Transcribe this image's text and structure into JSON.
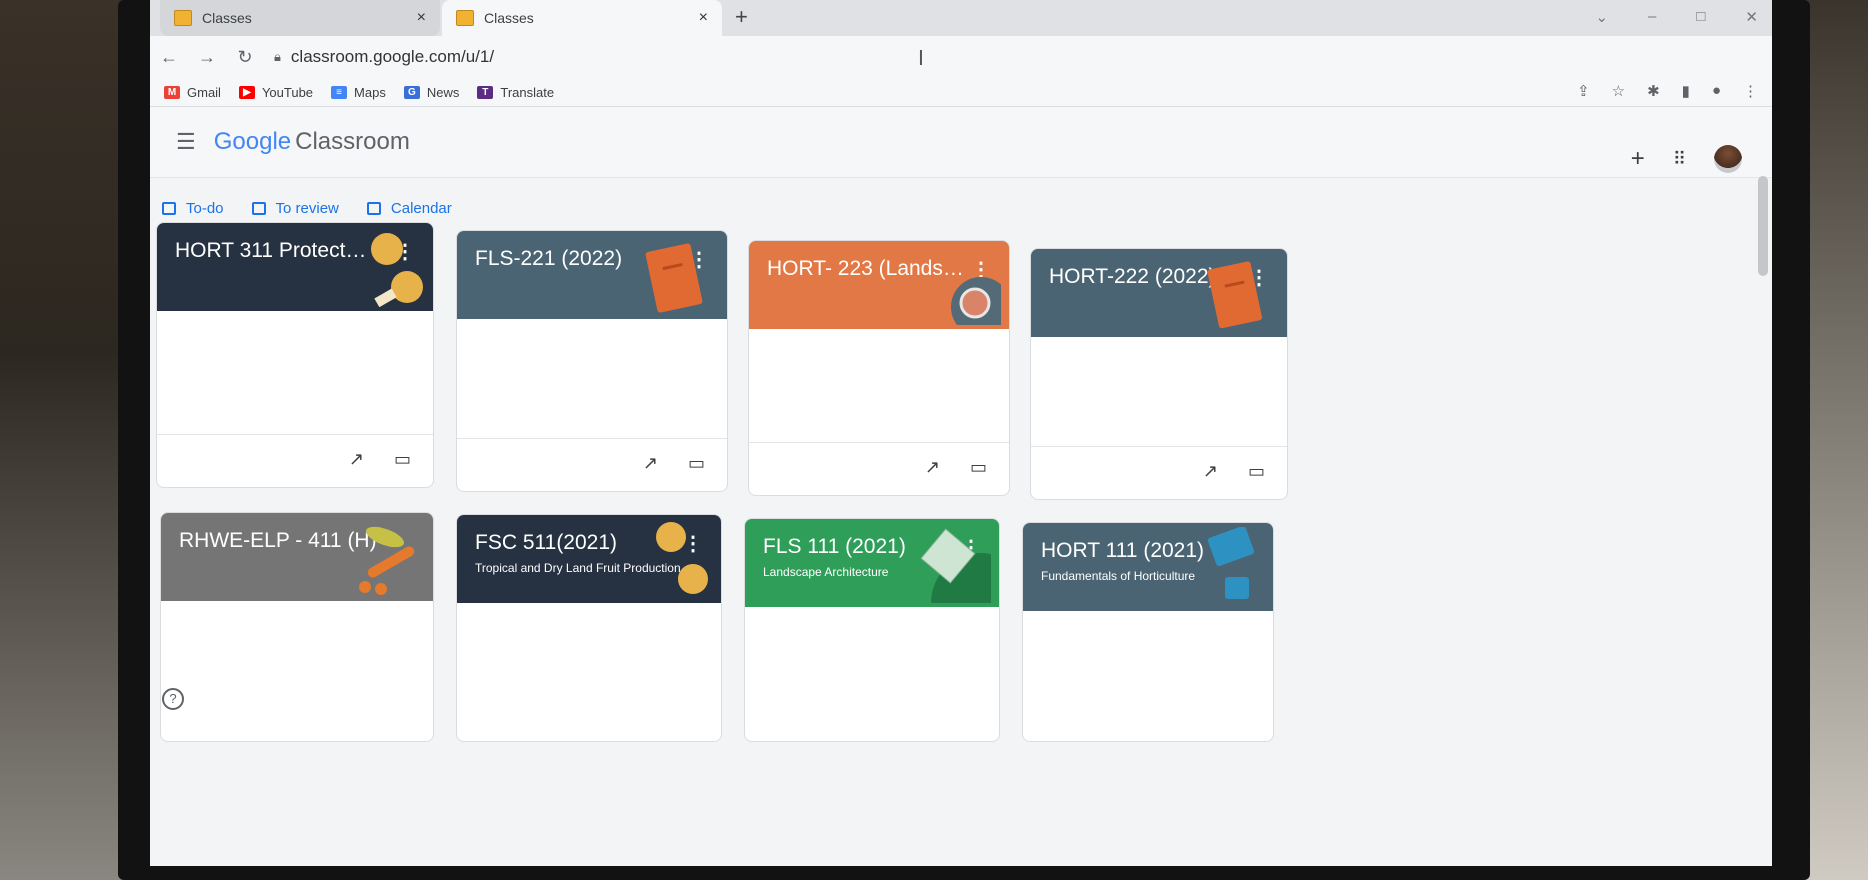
{
  "browser": {
    "tabs": [
      {
        "label": "Classes",
        "close": "×"
      },
      {
        "label": "Classes",
        "close": "×"
      }
    ],
    "new_tab": "+",
    "url": "classroom.google.com/u/1/",
    "bookmarks": [
      {
        "label": "Gmail",
        "icon": "gmail-icon",
        "color": "#ea4335",
        "glyph": "M"
      },
      {
        "label": "YouTube",
        "icon": "youtube-icon",
        "color": "#ff0000",
        "glyph": "▶"
      },
      {
        "label": "Maps",
        "icon": "maps-icon",
        "color": "#4285f4",
        "glyph": "≡"
      },
      {
        "label": "News",
        "icon": "news-icon",
        "color": "#3a6fd8",
        "glyph": "G"
      },
      {
        "label": "Translate",
        "icon": "translate-icon",
        "color": "#5b2c83",
        "glyph": "T"
      }
    ]
  },
  "app": {
    "logo_google": "Google",
    "logo_classroom": "Classroom"
  },
  "subnav": [
    {
      "label": "To-do"
    },
    {
      "label": "To review"
    },
    {
      "label": "Calendar"
    }
  ],
  "cards": [
    {
      "title": "HORT 311 Protected ...",
      "subtitle": "",
      "bg": "#263241"
    },
    {
      "title": "FLS-221 (2022)",
      "subtitle": "",
      "bg": "#4a6473"
    },
    {
      "title": "HORT- 223 (Landsca...",
      "subtitle": "",
      "bg": "#e17845"
    },
    {
      "title": "HORT-222 (2022)",
      "subtitle": "",
      "bg": "#4a6473"
    },
    {
      "title": "RHWE-ELP - 411 (H)",
      "subtitle": "",
      "bg": "#757575"
    },
    {
      "title": "FSC 511(2021)",
      "subtitle": "Tropical and Dry Land Fruit Production",
      "bg": "#263241"
    },
    {
      "title": "FLS 111 (2021)",
      "subtitle": "Landscape Architecture",
      "bg": "#2e9e59"
    },
    {
      "title": "HORT 111 (2021)",
      "subtitle": "Fundamentals of Horticulture",
      "bg": "#4a6473"
    }
  ]
}
